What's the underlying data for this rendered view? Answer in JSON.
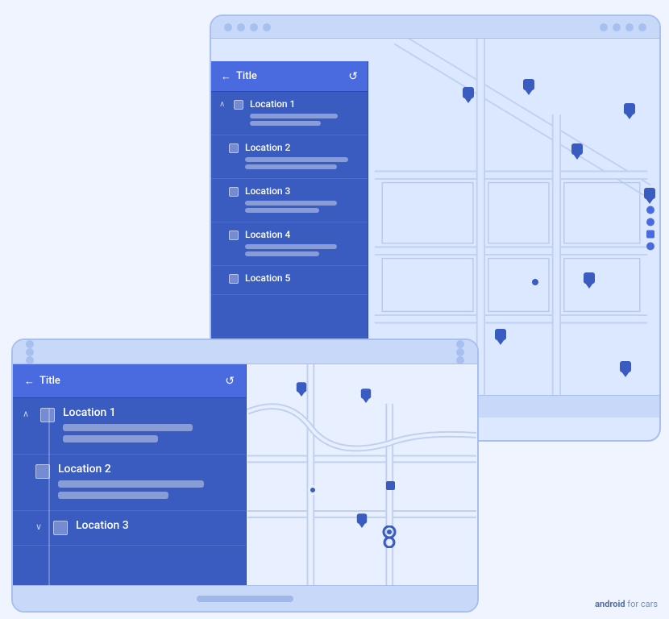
{
  "back_device": {
    "title": "Title",
    "refresh_label": "↺",
    "back_label": "←",
    "locations": [
      {
        "name": "Location 1",
        "bar1_width": "72%",
        "bar2_width": "50%",
        "has_chevron": true
      },
      {
        "name": "Location 2",
        "bar1_width": "80%",
        "bar2_width": "60%",
        "has_chevron": false
      },
      {
        "name": "Location 3",
        "bar1_width": "65%",
        "bar2_width": "55%",
        "has_chevron": false
      },
      {
        "name": "Location 4",
        "bar1_width": "60%",
        "bar2_width": "48%",
        "has_chevron": false
      },
      {
        "name": "Location 5",
        "bar1_width": "0%",
        "bar2_width": "0%",
        "has_chevron": false
      }
    ]
  },
  "front_device": {
    "title": "Title",
    "refresh_label": "↺",
    "back_label": "←",
    "locations": [
      {
        "name": "Location 1",
        "bar1_width": "75%",
        "bar2_width": "55%",
        "has_chevron": true,
        "expanded": true
      },
      {
        "name": "Location 2",
        "bar1_width": "82%",
        "bar2_width": "62%",
        "has_chevron": false,
        "expanded": false
      },
      {
        "name": "Location 3",
        "bar1_width": "0%",
        "bar2_width": "0%",
        "has_chevron": false,
        "expanded": false,
        "partial": true
      }
    ]
  },
  "watermark": {
    "text_bold": "android",
    "text_regular": " for cars"
  },
  "colors": {
    "brand_blue": "#3a5bbf",
    "light_blue": "#4a6bdf",
    "map_bg": "#dce8ff",
    "pin_blue": "#3a5bbf"
  }
}
